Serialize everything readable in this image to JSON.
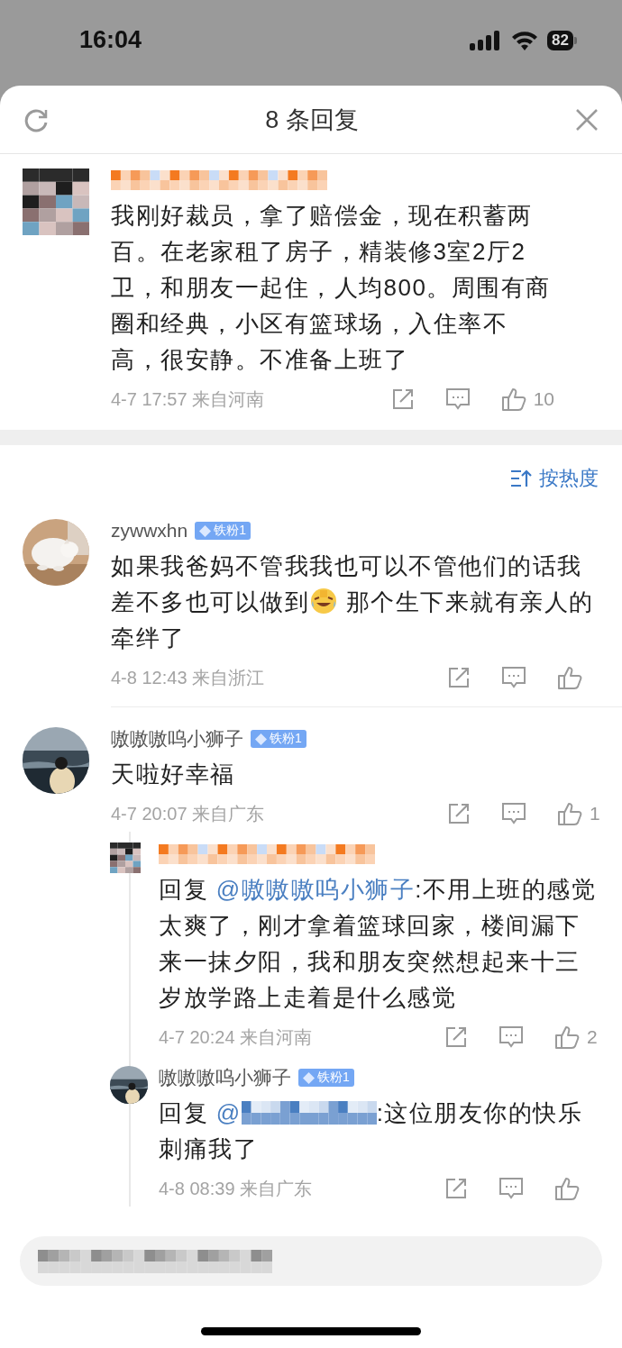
{
  "status_bar": {
    "time": "16:04",
    "battery": "82"
  },
  "header": {
    "title": "8 条回复"
  },
  "root_comment": {
    "avatar": {
      "kind": "mosaic"
    },
    "author_redacted": true,
    "text": "我刚好裁员，拿了赔偿金，现在积蓄两百。在老家租了房子，精装修3室2厅2卫，和朋友一起住，人均800。周围有商圈和经典，小区有篮球场，入住率不高，很安静。不准备上班了",
    "time": "4-7 17:57",
    "location": "来自河南",
    "likes": "10"
  },
  "sort": {
    "label": "按热度"
  },
  "comments": [
    {
      "avatar": {
        "kind": "cat"
      },
      "author": "zywwxhn",
      "badge": "铁粉1",
      "text": "如果我爸妈不管我我也可以不管他们的话我差不多也可以做到",
      "emoji": true,
      "text_after": " 那个生下来就有亲人的牵绊了",
      "time": "4-8 12:43",
      "location": "来自浙江"
    },
    {
      "avatar": {
        "kind": "seaside"
      },
      "author": "嗷嗷嗷呜小狮子",
      "badge": "铁粉1",
      "text": "天啦好幸福",
      "time": "4-7 20:07",
      "location": "来自广东",
      "likes": "1",
      "replies": [
        {
          "avatar": {
            "kind": "mosaic"
          },
          "author_redacted": true,
          "reply_word": "回复",
          "mention": "@嗷嗷嗷呜小狮子",
          "text": ":不用上班的感觉太爽了，刚才拿着篮球回家，楼间漏下来一抹夕阳，我和朋友突然想起来十三岁放学路上走着是什么感觉",
          "time": "4-7 20:24",
          "location": "来自河南",
          "likes": "2"
        },
        {
          "avatar": {
            "kind": "seaside"
          },
          "author": "嗷嗷嗷呜小狮子",
          "badge": "铁粉1",
          "reply_word": "回复",
          "mention": "@",
          "mention_redacted": true,
          "text": ":这位朋友你的快乐刺痛我了",
          "time": "4-8 08:39",
          "location": "来自广东"
        }
      ]
    }
  ],
  "input": {
    "placeholder_redacted": true
  }
}
